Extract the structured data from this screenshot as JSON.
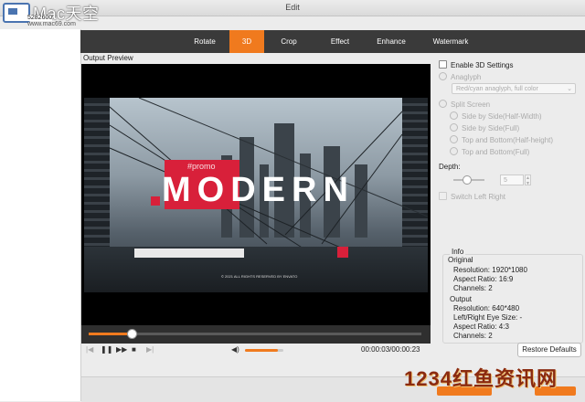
{
  "window": {
    "title": "Edit"
  },
  "watermark_top": {
    "brand": "Mac天空",
    "number": "5282600",
    "url": "www.mac69.com"
  },
  "watermark_bottom": {
    "text": "1234红鱼资讯网"
  },
  "tabs": [
    {
      "label": "Rotate",
      "active": false
    },
    {
      "label": "3D",
      "active": true
    },
    {
      "label": "Crop",
      "active": false
    },
    {
      "label": "Effect",
      "active": false
    },
    {
      "label": "Enhance",
      "active": false
    },
    {
      "label": "Watermark",
      "active": false
    }
  ],
  "preview": {
    "label": "Output Preview",
    "video_promo": "#promo",
    "video_headline": "MODERN",
    "video_tagline": "© 2021 ALL RIGHTS RESERVED BY ENVATO"
  },
  "player": {
    "progress_fraction": 0.13,
    "volume_fraction": 0.85,
    "timecode": "00:00:03/00:00:23"
  },
  "settings": {
    "enable_3d": {
      "label": "Enable 3D Settings",
      "checked": false
    },
    "anaglyph": {
      "label": "Anaglyph",
      "enabled": false
    },
    "anaglyph_select": {
      "value": "Red/cyan anaglyph, full color"
    },
    "split_screen": {
      "label": "Split Screen",
      "enabled": false
    },
    "split_options": [
      {
        "label": "Side by Side(Half-Width)"
      },
      {
        "label": "Side by Side(Full)"
      },
      {
        "label": "Top and Bottom(Half-height)"
      },
      {
        "label": "Top and Bottom(Full)"
      }
    ],
    "depth": {
      "label": "Depth:",
      "value": "5",
      "slider_fraction": 0.4
    },
    "switch": {
      "label": "Switch Left Right",
      "checked": false
    }
  },
  "info": {
    "title": "Info",
    "original_heading": "Original",
    "original_resolution": "Resolution: 1920*1080",
    "original_aspect": "Aspect Ratio: 16:9",
    "original_channels": "Channels: 2",
    "output_heading": "Output",
    "output_resolution": "Resolution: 640*480",
    "output_eye": "Left/Right Eye Size: -",
    "output_aspect": "Aspect Ratio: 4:3",
    "output_channels": "Channels: 2"
  },
  "buttons": {
    "restore": "Restore Defaults"
  },
  "colors": {
    "accent": "#f07a1e",
    "tabbar": "#3a3a3a",
    "promo_red": "#d8203a"
  }
}
